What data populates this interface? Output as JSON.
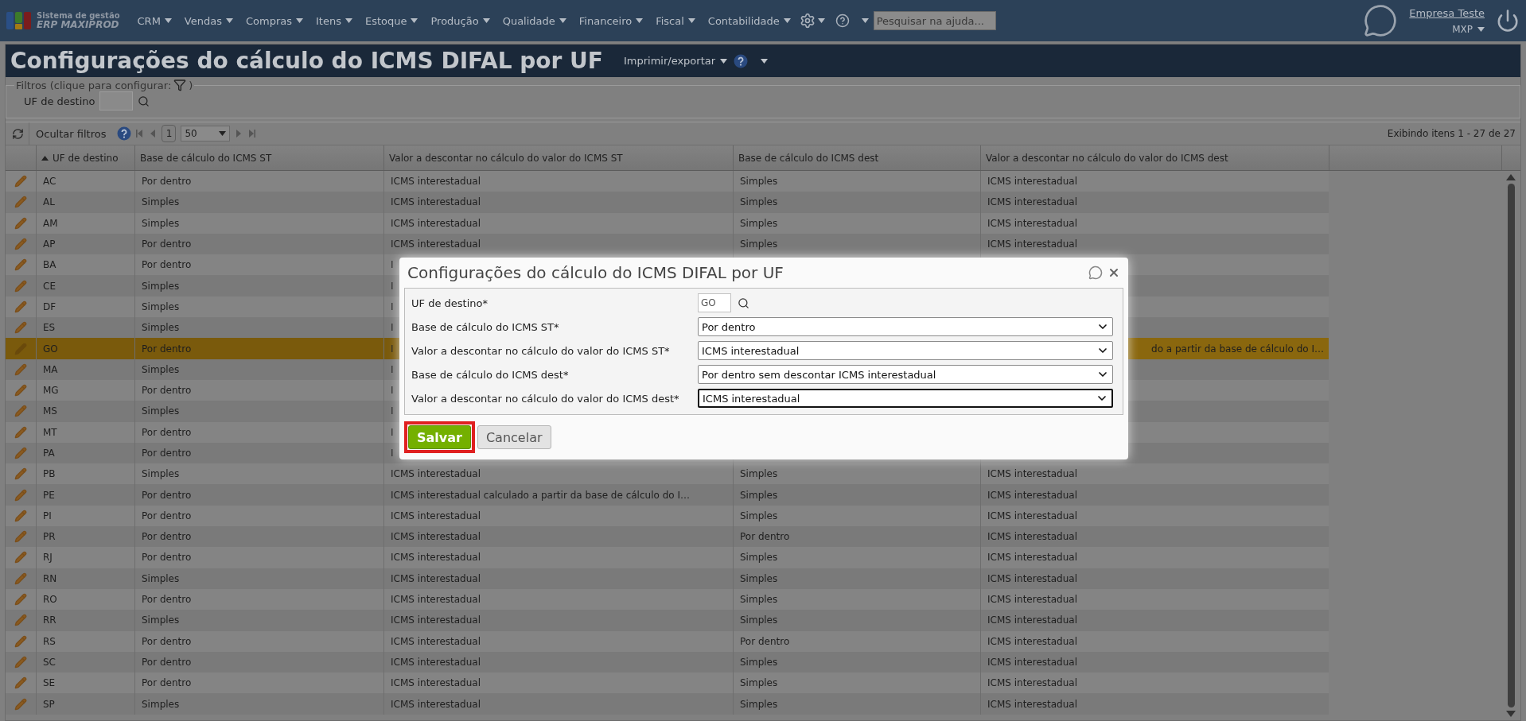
{
  "nav": {
    "logo_top": "Sistema de gestão",
    "logo_bottom": "ERP MAXIPROD",
    "menus": [
      "CRM",
      "Vendas",
      "Compras",
      "Itens",
      "Estoque",
      "Produção",
      "Qualidade",
      "Financeiro",
      "Fiscal",
      "Contabilidade"
    ],
    "search_placeholder": "Pesquisar na ajuda...",
    "company": "Empresa Teste",
    "user": "MXP"
  },
  "page": {
    "title": "Configurações do cálculo do ICMS DIFAL por UF",
    "export": "Imprimir/exportar"
  },
  "filters": {
    "legend": "Filtros (clique para configurar:",
    "legend_end": ")",
    "fields": [
      {
        "label": "UF de destino"
      }
    ]
  },
  "toolbar": {
    "hide_filters": "Ocultar filtros",
    "page": "1",
    "page_size": "50",
    "summary": "Exibindo itens 1 - 27 de 27"
  },
  "table": {
    "columns": [
      {
        "label": "UF de destino",
        "sort_ascending": true
      },
      {
        "label": "Base de cálculo do ICMS ST"
      },
      {
        "label": "Valor a descontar no cálculo do valor do ICMS ST"
      },
      {
        "label": "Base de cálculo do ICMS dest"
      },
      {
        "label": "Valor a descontar no cálculo do valor do ICMS dest"
      }
    ],
    "rows": [
      {
        "uf": "AC",
        "base_st": "Por dentro",
        "valor_st": "ICMS interestadual",
        "base_dest": "Simples",
        "valor_dest": "ICMS interestadual",
        "selected": false
      },
      {
        "uf": "AL",
        "base_st": "Simples",
        "valor_st": "ICMS interestadual",
        "base_dest": "Simples",
        "valor_dest": "ICMS interestadual",
        "selected": false
      },
      {
        "uf": "AM",
        "base_st": "Simples",
        "valor_st": "ICMS interestadual",
        "base_dest": "Simples",
        "valor_dest": "ICMS interestadual",
        "selected": false
      },
      {
        "uf": "AP",
        "base_st": "Por dentro",
        "valor_st": "ICMS interestadual",
        "base_dest": "Simples",
        "valor_dest": "ICMS interestadual",
        "selected": false
      },
      {
        "uf": "BA",
        "base_st": "Por dentro",
        "valor_st": "I",
        "selected": false
      },
      {
        "uf": "CE",
        "base_st": "Simples",
        "valor_st": "I",
        "selected": false
      },
      {
        "uf": "DF",
        "base_st": "Simples",
        "valor_st": "I",
        "selected": false
      },
      {
        "uf": "ES",
        "base_st": "Simples",
        "valor_st": "I",
        "selected": false
      },
      {
        "uf": "GO",
        "base_st": "Por dentro",
        "valor_st": "I",
        "valor_dest": "do a partir da base de cálculo do I…",
        "selected": true
      },
      {
        "uf": "MA",
        "base_st": "Simples",
        "valor_st": "I",
        "selected": false
      },
      {
        "uf": "MG",
        "base_st": "Por dentro",
        "valor_st": "I",
        "selected": false
      },
      {
        "uf": "MS",
        "base_st": "Simples",
        "valor_st": "I",
        "selected": false
      },
      {
        "uf": "MT",
        "base_st": "Por dentro",
        "valor_st": "I",
        "selected": false
      },
      {
        "uf": "PA",
        "base_st": "Por dentro",
        "valor_st": "I",
        "selected": false
      },
      {
        "uf": "PB",
        "base_st": "Simples",
        "valor_st": "ICMS interestadual",
        "base_dest": "Simples",
        "valor_dest": "ICMS interestadual",
        "selected": false
      },
      {
        "uf": "PE",
        "base_st": "Por dentro",
        "valor_st": "ICMS interestadual calculado a partir da base de cálculo do I…",
        "base_dest": "Simples",
        "valor_dest": "ICMS interestadual",
        "selected": false
      },
      {
        "uf": "PI",
        "base_st": "Por dentro",
        "valor_st": "ICMS interestadual",
        "base_dest": "Simples",
        "valor_dest": "ICMS interestadual",
        "selected": false
      },
      {
        "uf": "PR",
        "base_st": "Por dentro",
        "valor_st": "ICMS interestadual",
        "base_dest": "Por dentro",
        "valor_dest": "ICMS interestadual",
        "selected": false
      },
      {
        "uf": "RJ",
        "base_st": "Por dentro",
        "valor_st": "ICMS interestadual",
        "base_dest": "Simples",
        "valor_dest": "ICMS interestadual",
        "selected": false
      },
      {
        "uf": "RN",
        "base_st": "Simples",
        "valor_st": "ICMS interestadual",
        "base_dest": "Simples",
        "valor_dest": "ICMS interestadual",
        "selected": false
      },
      {
        "uf": "RO",
        "base_st": "Por dentro",
        "valor_st": "ICMS interestadual",
        "base_dest": "Simples",
        "valor_dest": "ICMS interestadual",
        "selected": false
      },
      {
        "uf": "RR",
        "base_st": "Simples",
        "valor_st": "ICMS interestadual",
        "base_dest": "Simples",
        "valor_dest": "ICMS interestadual",
        "selected": false
      },
      {
        "uf": "RS",
        "base_st": "Por dentro",
        "valor_st": "ICMS interestadual",
        "base_dest": "Por dentro",
        "valor_dest": "ICMS interestadual",
        "selected": false
      },
      {
        "uf": "SC",
        "base_st": "Por dentro",
        "valor_st": "ICMS interestadual",
        "base_dest": "Simples",
        "valor_dest": "ICMS interestadual",
        "selected": false
      },
      {
        "uf": "SE",
        "base_st": "Por dentro",
        "valor_st": "ICMS interestadual",
        "base_dest": "Simples",
        "valor_dest": "ICMS interestadual",
        "selected": false
      },
      {
        "uf": "SP",
        "base_st": "Simples",
        "valor_st": "ICMS interestadual",
        "base_dest": "Simples",
        "valor_dest": "ICMS interestadual",
        "selected": false
      }
    ]
  },
  "dialog": {
    "title": "Configurações do cálculo do ICMS DIFAL por UF",
    "fields": [
      {
        "label": "UF de destino*",
        "kind": "text",
        "value": "GO",
        "focused": false
      },
      {
        "label": "Base de cálculo do ICMS ST*",
        "kind": "select",
        "value": "Por dentro",
        "focused": false
      },
      {
        "label": "Valor a descontar no cálculo do valor do ICMS ST*",
        "kind": "select",
        "value": "ICMS interestadual",
        "focused": false
      },
      {
        "label": "Base de cálculo do ICMS dest*",
        "kind": "select",
        "value": "Por dentro sem descontar ICMS interestadual",
        "focused": false
      },
      {
        "label": "Valor a descontar no cálculo do valor do ICMS dest*",
        "kind": "select",
        "value": "ICMS interestadual",
        "focused": true
      }
    ],
    "buttons": [
      {
        "label": "Salvar",
        "kind": "primary",
        "highlighted": true
      },
      {
        "label": "Cancelar",
        "kind": "secondary",
        "highlighted": false
      }
    ]
  }
}
